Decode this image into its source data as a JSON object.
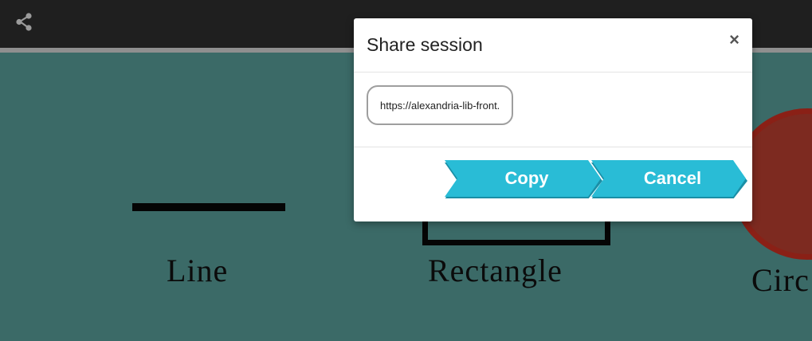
{
  "topbar": {
    "share_icon": "share-icon"
  },
  "canvas": {
    "shapes": [
      {
        "label": "Line"
      },
      {
        "label": "Rectangle"
      },
      {
        "label": "Circ"
      }
    ]
  },
  "dialog": {
    "title": "Share session",
    "close_symbol": "×",
    "url_value": "https://alexandria-lib-front.",
    "copy_label": "Copy",
    "cancel_label": "Cancel"
  },
  "colors": {
    "topbar": "#1f1f1f",
    "canvas": "#3b6a67",
    "button": "#29bcd6",
    "button_shadow": "#1a8fa6",
    "circle": "#7d2a20"
  }
}
